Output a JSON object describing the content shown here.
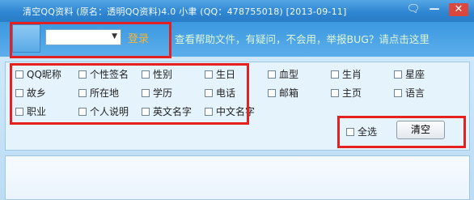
{
  "window": {
    "title": "清空QQ资料 (原名：透明QQ资料)4.0   小聿 (QQ：478755018)   [2013-09-11]"
  },
  "topbar": {
    "combo_value": "",
    "login_label": "登录",
    "help_text": "查看帮助文件，有疑问，不会用，举报BUG？请点击这里"
  },
  "options": {
    "row1": [
      "QQ昵称",
      "个性签名",
      "性别",
      "生日",
      "血型",
      "生肖",
      "星座"
    ],
    "row2": [
      "故乡",
      "所在地",
      "学历",
      "电话",
      "邮箱",
      "主页",
      "语言"
    ],
    "row3": [
      "职业",
      "个人说明",
      "英文名字",
      "中文名字"
    ]
  },
  "actions": {
    "select_all_label": "全选",
    "clear_label": "清空"
  },
  "colors": {
    "annotation_red": "#e62020",
    "login_color": "#f3b53a",
    "help_color": "#dff6d8"
  }
}
